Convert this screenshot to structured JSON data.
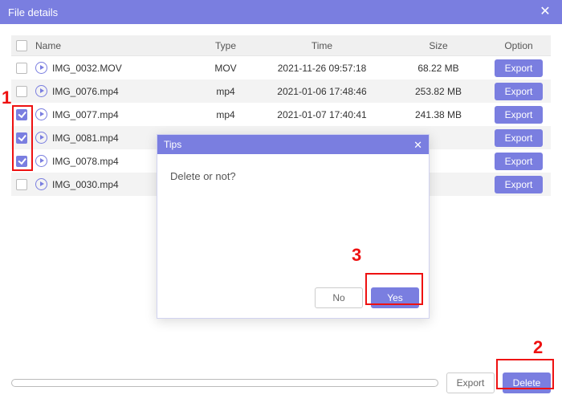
{
  "window": {
    "title": "File details"
  },
  "columns": {
    "name": "Name",
    "type": "Type",
    "time": "Time",
    "size": "Size",
    "option": "Option"
  },
  "row_button_label": "Export",
  "files": [
    {
      "name": "IMG_0032.MOV",
      "type": "MOV",
      "time": "2021-11-26 09:57:18",
      "size": "68.22 MB",
      "checked": false
    },
    {
      "name": "IMG_0076.mp4",
      "type": "mp4",
      "time": "2021-01-06 17:48:46",
      "size": "253.82 MB",
      "checked": false
    },
    {
      "name": "IMG_0077.mp4",
      "type": "mp4",
      "time": "2021-01-07 17:40:41",
      "size": "241.38 MB",
      "checked": true
    },
    {
      "name": "IMG_0081.mp4",
      "type": "",
      "time": "",
      "size": "",
      "checked": true
    },
    {
      "name": "IMG_0078.mp4",
      "type": "",
      "time": "",
      "size": "",
      "checked": true
    },
    {
      "name": "IMG_0030.mp4",
      "type": "",
      "time": "",
      "size": "",
      "checked": false
    }
  ],
  "modal": {
    "title": "Tips",
    "message": "Delete or not?",
    "no": "No",
    "yes": "Yes"
  },
  "footer": {
    "export": "Export",
    "delete": "Delete"
  },
  "annotations": {
    "one": "1",
    "two": "2",
    "three": "3"
  }
}
